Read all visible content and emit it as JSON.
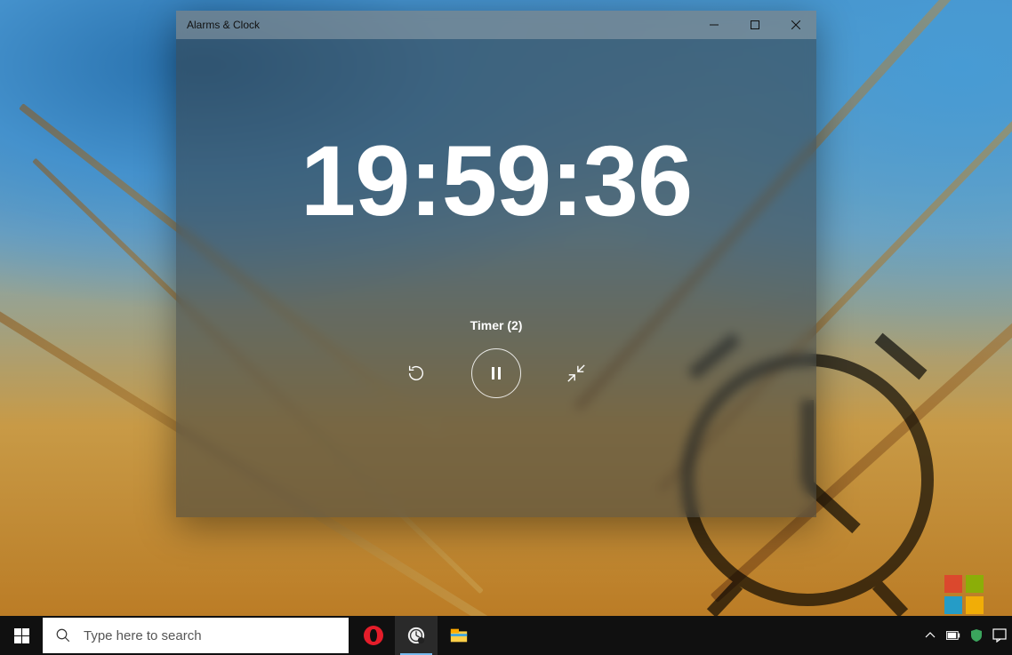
{
  "window": {
    "title": "Alarms & Clock"
  },
  "timer": {
    "time": "19:59:36",
    "label": "Timer (2)"
  },
  "search": {
    "placeholder": "Type here to search"
  },
  "icons": {
    "reset": "reset-icon",
    "pause": "pause-icon",
    "collapse": "collapse-icon",
    "minimize": "minimize-icon",
    "maximize": "maximize-icon",
    "close": "close-icon"
  }
}
